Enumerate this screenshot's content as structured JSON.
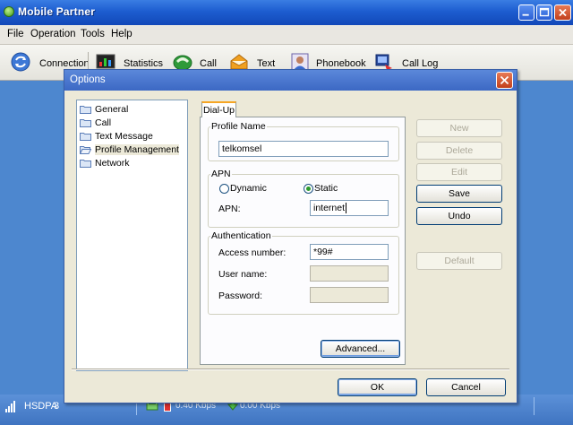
{
  "window": {
    "title": "Mobile Partner"
  },
  "menubar": {
    "file": "File",
    "operation": "Operation",
    "tools": "Tools",
    "help": "Help"
  },
  "toolbar": {
    "connection": "Connection",
    "statistics": "Statistics",
    "call": "Call",
    "text": "Text",
    "phonebook": "Phonebook",
    "call_log": "Call Log"
  },
  "statusbar": {
    "network": "HSDPA",
    "network_suffix": "3",
    "upload_speed": "0.40 Kbps",
    "download_speed": "0.00 Kbps"
  },
  "dialog": {
    "title": "Options",
    "tree": [
      "General",
      "Call",
      "Text Message",
      "Profile Management",
      "Network"
    ],
    "selected": "Profile Management",
    "tab": "Dial-Up",
    "profile_group": "Profile Name",
    "profile_value": "telkomsel",
    "apn_group": "APN",
    "apn_dynamic": "Dynamic",
    "apn_static": "Static",
    "apn_mode": "Static",
    "apn_label": "APN:",
    "apn_value": "internet",
    "auth_group": "Authentication",
    "access_label": "Access number:",
    "access_value": "*99#",
    "user_label": "User name:",
    "user_value": "",
    "password_label": "Password:",
    "password_value": "",
    "advanced_button": "Advanced...",
    "buttons": {
      "new": "New",
      "delete": "Delete",
      "edit": "Edit",
      "save": "Save",
      "undo": "Undo",
      "default": "Default"
    },
    "ok": "OK",
    "cancel": "Cancel"
  },
  "colors": {
    "titlebar": "#1d5dd0",
    "desktop": "#4d87cf",
    "dialog_face": "#ece9d8",
    "tab_highlight": "#f6a624",
    "close_button": "#c2401c"
  },
  "icons": {
    "app": "mobile-partner-logo",
    "connection": "connection-icon",
    "statistics": "statistics-icon",
    "call": "phone-icon",
    "text": "envelope-icon",
    "phonebook": "phonebook-icon",
    "call_log": "call-log-icon",
    "tree": "folder-icon"
  }
}
